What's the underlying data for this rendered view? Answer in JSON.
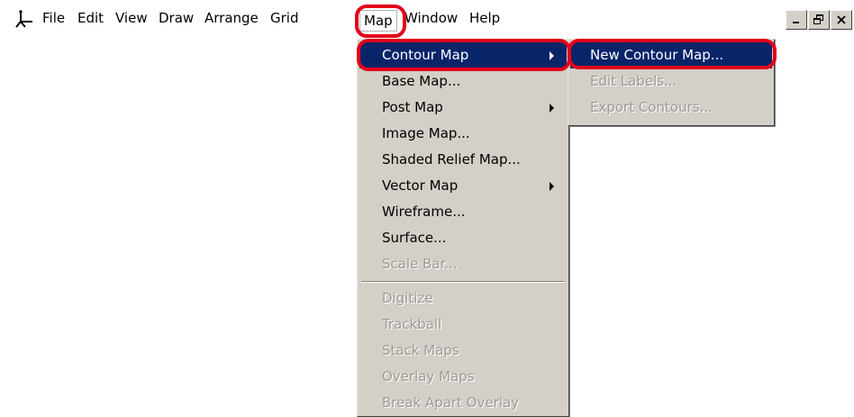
{
  "menubar": {
    "items": [
      "File",
      "Edit",
      "View",
      "Draw",
      "Arrange",
      "Grid",
      "Map",
      "Window",
      "Help"
    ]
  },
  "window_controls": {
    "icons": [
      "minimize-icon",
      "restore-icon",
      "close-icon"
    ]
  },
  "map_menu": {
    "items": [
      {
        "label": "Contour Map",
        "submenu": true,
        "selected": true
      },
      {
        "label": "Base Map..."
      },
      {
        "label": "Post Map",
        "submenu": true
      },
      {
        "label": "Image Map..."
      },
      {
        "label": "Shaded Relief Map..."
      },
      {
        "label": "Vector Map",
        "submenu": true
      },
      {
        "label": "Wireframe..."
      },
      {
        "label": "Surface..."
      },
      {
        "label": "Scale Bar...",
        "disabled": true
      },
      {
        "label": "Digitize",
        "disabled": true
      },
      {
        "label": "Trackball",
        "disabled": true
      },
      {
        "label": "Stack Maps",
        "disabled": true
      },
      {
        "label": "Overlay Maps",
        "disabled": true
      },
      {
        "label": "Break Apart Overlay",
        "disabled": true
      }
    ]
  },
  "contour_submenu": {
    "items": [
      {
        "label": "New Contour Map...",
        "selected": true
      },
      {
        "label": "Edit Labels...",
        "disabled": true
      },
      {
        "label": "Export Contours...",
        "disabled": true
      }
    ]
  },
  "colors": {
    "highlight_ring": "#e3001b",
    "selection": "#0a246a",
    "menu_bg": "#d4d0c8"
  }
}
